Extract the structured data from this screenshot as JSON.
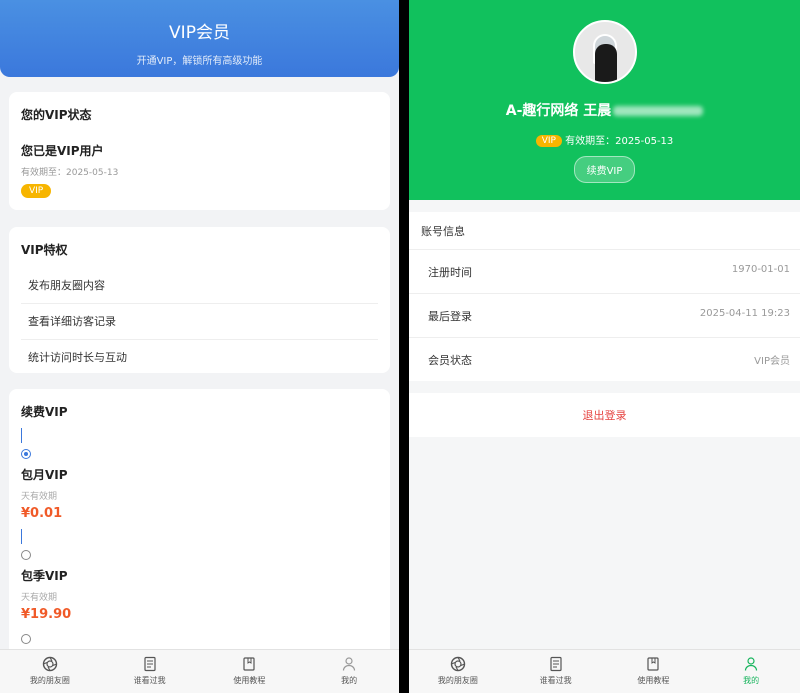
{
  "left": {
    "header": {
      "title": "VIP会员",
      "subtitle": "开通VIP，解锁所有高级功能"
    },
    "status": {
      "title": "您的VIP状态",
      "line1": "您已是VIP用户",
      "expiry": "有效期至：2025-05-13",
      "badge": "VIP"
    },
    "privileges": {
      "title": "VIP特权",
      "items": [
        "发布朋友圈内容",
        "查看详细访客记录",
        "统计访问时长与互动"
      ]
    },
    "renew": {
      "title": "续费VIP",
      "plans": [
        {
          "name": "包月VIP",
          "valid": "天有效期",
          "price": "¥0.01",
          "checked": true
        },
        {
          "name": "包季VIP",
          "valid": "天有效期",
          "price": "¥19.90",
          "checked": false
        }
      ]
    }
  },
  "right": {
    "profile": {
      "name": "A-趣行网络 王晨",
      "vip_badge": "VIP",
      "expiry": "有效期至：2025-05-13",
      "renew_button": "续费VIP"
    },
    "info": {
      "title": "账号信息",
      "rows": [
        {
          "key": "注册时间",
          "value": "1970-01-01"
        },
        {
          "key": "最后登录",
          "value": "2025-04-11 19:23"
        },
        {
          "key": "会员状态",
          "value": "VIP会员"
        }
      ]
    },
    "logout": "退出登录"
  },
  "tabbar": {
    "items": [
      {
        "label": "我的朋友圈",
        "icon": "aperture-icon"
      },
      {
        "label": "谁看过我",
        "icon": "document-icon"
      },
      {
        "label": "使用教程",
        "icon": "book-icon"
      },
      {
        "label": "我的",
        "icon": "user-icon"
      }
    ],
    "active_color": "#16b45c"
  },
  "colors": {
    "left_header": "#3b78dc",
    "right_header": "#11c15d",
    "price": "#f05a28",
    "badge": "#f7b500",
    "logout": "#e64340"
  }
}
